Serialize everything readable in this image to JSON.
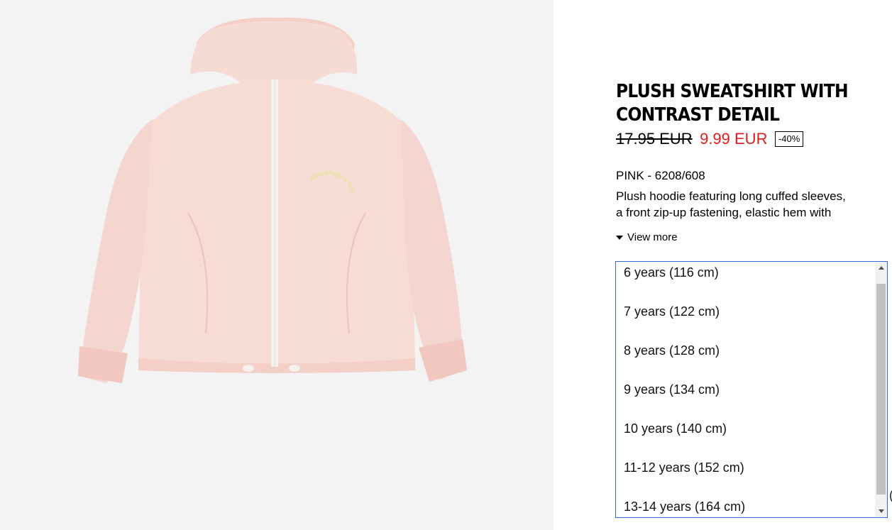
{
  "product": {
    "title": "PLUSH SWEATSHIRT WITH CONTRAST DETAIL",
    "price_original": "17.95 EUR",
    "price_sale": "9.99 EUR",
    "discount": "-40%",
    "color_ref": "PINK - 6208/608",
    "description_line1": "Plush hoodie featuring long cuffed sleeves,",
    "description_line2": "a front zip-up fastening, elastic hem with",
    "view_more": "View more",
    "print_text": "ADVENTURE IS OUT THERE"
  },
  "sizes": [
    "6 years (116 cm)",
    "7 years (122 cm)",
    "8 years (128 cm)",
    "9 years (134 cm)",
    "10 years (140 cm)",
    "11-12 years (152 cm)",
    "13-14 years (164 cm)"
  ],
  "edge_text": "(",
  "colors": {
    "sale_price": "#e11d1d",
    "listbox_border": "#2f6bd8",
    "garment": "#f5d7d2"
  }
}
